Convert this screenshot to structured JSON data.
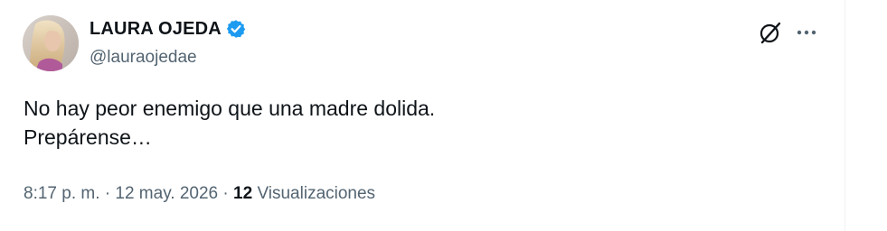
{
  "author": {
    "display_name": "LAURA OJEDA",
    "handle": "@lauraojedae",
    "verified": true,
    "verified_color": "#1d9bf0"
  },
  "tweet": {
    "lines": [
      "No hay peor enemigo que una madre dolida.",
      "Prepárense…"
    ]
  },
  "meta": {
    "time": "8:17 p. m.",
    "separator": "·",
    "date": "12 may. 2026",
    "views_count": "12",
    "views_label": "Visualizaciones"
  },
  "icons": {
    "grok": "grok-icon",
    "more": "more-icon"
  }
}
